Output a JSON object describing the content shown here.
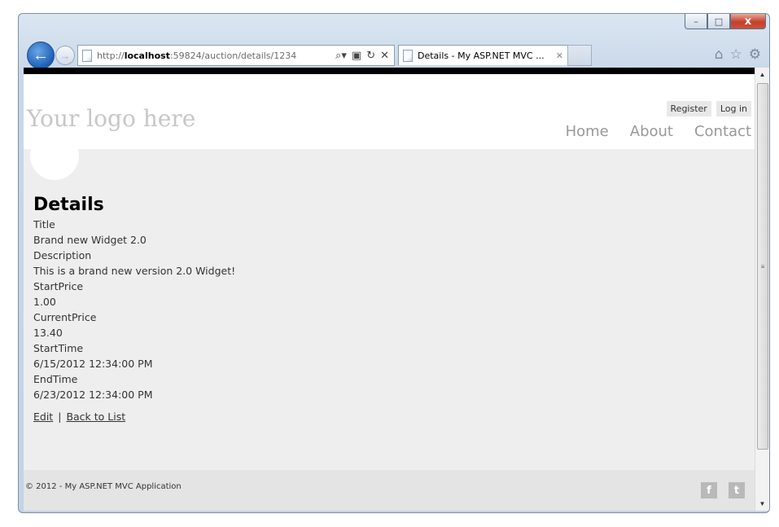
{
  "browser": {
    "url_prefix": "http://",
    "url_host": "localhost",
    "url_rest": ":59824/auction/details/1234",
    "tab_title": "Details - My ASP.NET MVC ...",
    "window_controls": {
      "minimize": "–",
      "maximize": "□",
      "close": "x"
    }
  },
  "site": {
    "logo": "Your logo here",
    "login": {
      "register": "Register",
      "login": "Log in"
    },
    "menu": [
      "Home",
      "About",
      "Contact"
    ]
  },
  "details": {
    "heading": "Details",
    "fields": [
      {
        "label": "Title",
        "value": "Brand new Widget 2.0"
      },
      {
        "label": "Description",
        "value": "This is a brand new version 2.0 Widget!"
      },
      {
        "label": "StartPrice",
        "value": "1.00"
      },
      {
        "label": "CurrentPrice",
        "value": "13.40"
      },
      {
        "label": "StartTime",
        "value": "6/15/2012 12:34:00 PM"
      },
      {
        "label": "EndTime",
        "value": "6/23/2012 12:34:00 PM"
      }
    ],
    "actions": {
      "edit": "Edit",
      "separator": "|",
      "back": "Back to List"
    }
  },
  "footer": {
    "copyright": "© 2012 - My ASP.NET MVC Application",
    "social": {
      "facebook": "f",
      "twitter": "t"
    }
  }
}
